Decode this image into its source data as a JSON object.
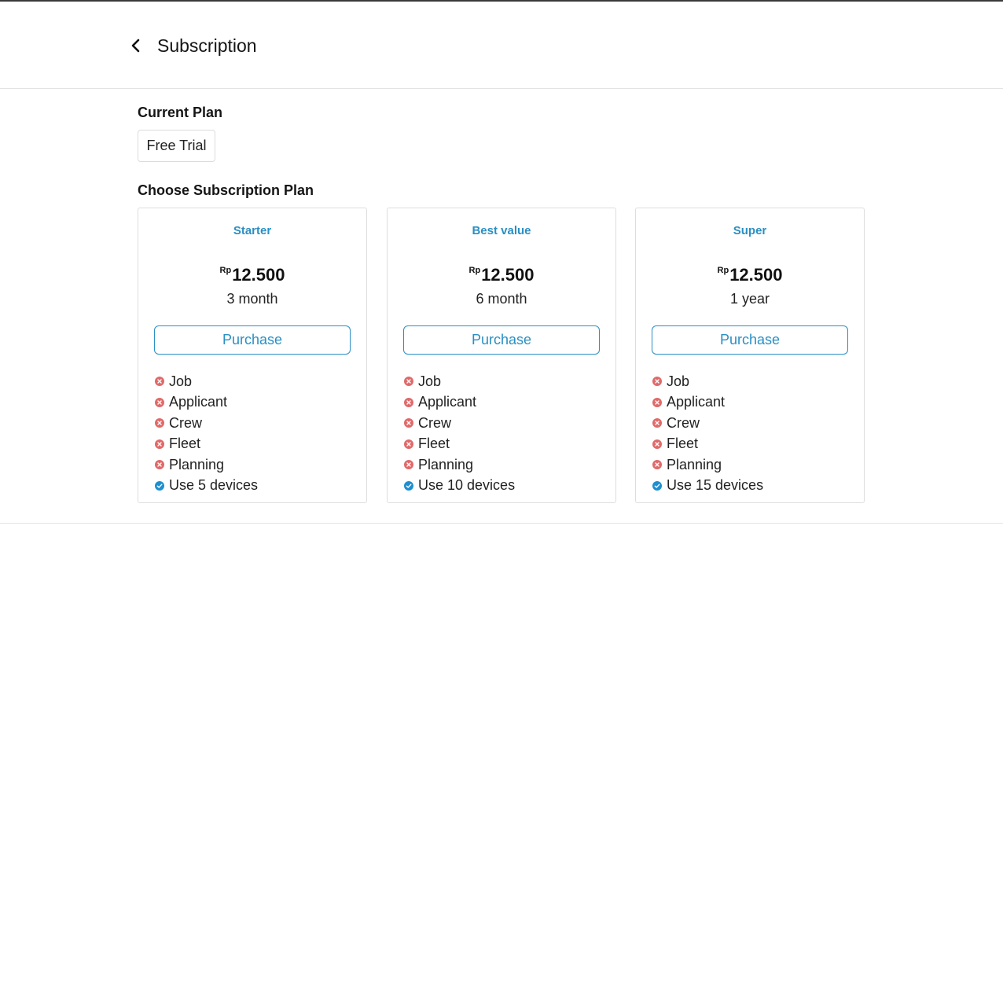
{
  "header": {
    "title": "Subscription",
    "back_icon": "chevron-left-icon"
  },
  "current_plan": {
    "label": "Current Plan",
    "value": "Free Trial"
  },
  "choose": {
    "label": "Choose Subscription Plan"
  },
  "colors": {
    "accent": "#2a8fc3",
    "excluded": "#e06a6a",
    "included": "#1e8fcf"
  },
  "plans": [
    {
      "name": "Starter",
      "currency": "Rp",
      "price": "12.500",
      "period": "3 month",
      "button": "Purchase",
      "features": [
        {
          "label": "Job",
          "included": false
        },
        {
          "label": "Applicant",
          "included": false
        },
        {
          "label": "Crew",
          "included": false
        },
        {
          "label": "Fleet",
          "included": false
        },
        {
          "label": "Planning",
          "included": false
        },
        {
          "label": "Use 5 devices",
          "included": true
        }
      ]
    },
    {
      "name": "Best value",
      "currency": "Rp",
      "price": "12.500",
      "period": "6 month",
      "button": "Purchase",
      "features": [
        {
          "label": "Job",
          "included": false
        },
        {
          "label": "Applicant",
          "included": false
        },
        {
          "label": "Crew",
          "included": false
        },
        {
          "label": "Fleet",
          "included": false
        },
        {
          "label": "Planning",
          "included": false
        },
        {
          "label": "Use 10 devices",
          "included": true
        }
      ]
    },
    {
      "name": "Super",
      "currency": "Rp",
      "price": "12.500",
      "period": "1 year",
      "button": "Purchase",
      "features": [
        {
          "label": "Job",
          "included": false
        },
        {
          "label": "Applicant",
          "included": false
        },
        {
          "label": "Crew",
          "included": false
        },
        {
          "label": "Fleet",
          "included": false
        },
        {
          "label": "Planning",
          "included": false
        },
        {
          "label": "Use 15 devices",
          "included": true
        }
      ]
    }
  ]
}
